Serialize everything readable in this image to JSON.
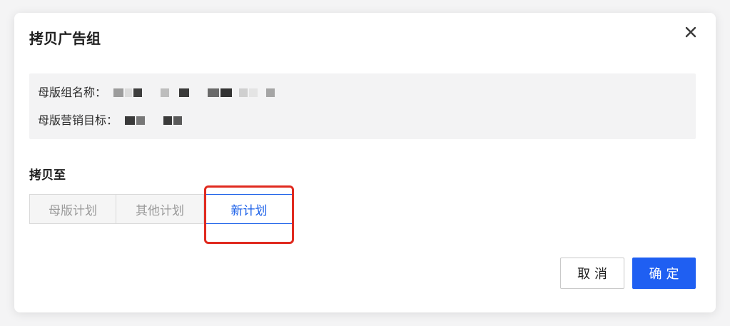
{
  "dialog": {
    "title": "拷贝广告组",
    "close_icon": "close-icon",
    "info": {
      "group_name_label": "母版组名称：",
      "marketing_goal_label": "母版营销目标："
    },
    "copy_to": {
      "label": "拷贝至",
      "options": [
        {
          "label": "母版计划",
          "state": "disabled"
        },
        {
          "label": "其他计划",
          "state": "disabled"
        },
        {
          "label": "新计划",
          "state": "selected"
        }
      ]
    },
    "buttons": {
      "cancel_label": "取消",
      "confirm_label": "确定"
    }
  },
  "colors": {
    "primary": "#1f5ff2",
    "active_outline": "#1a5fe8",
    "highlight_annotation": "#e02a1f",
    "info_bg": "#f3f3f4"
  }
}
